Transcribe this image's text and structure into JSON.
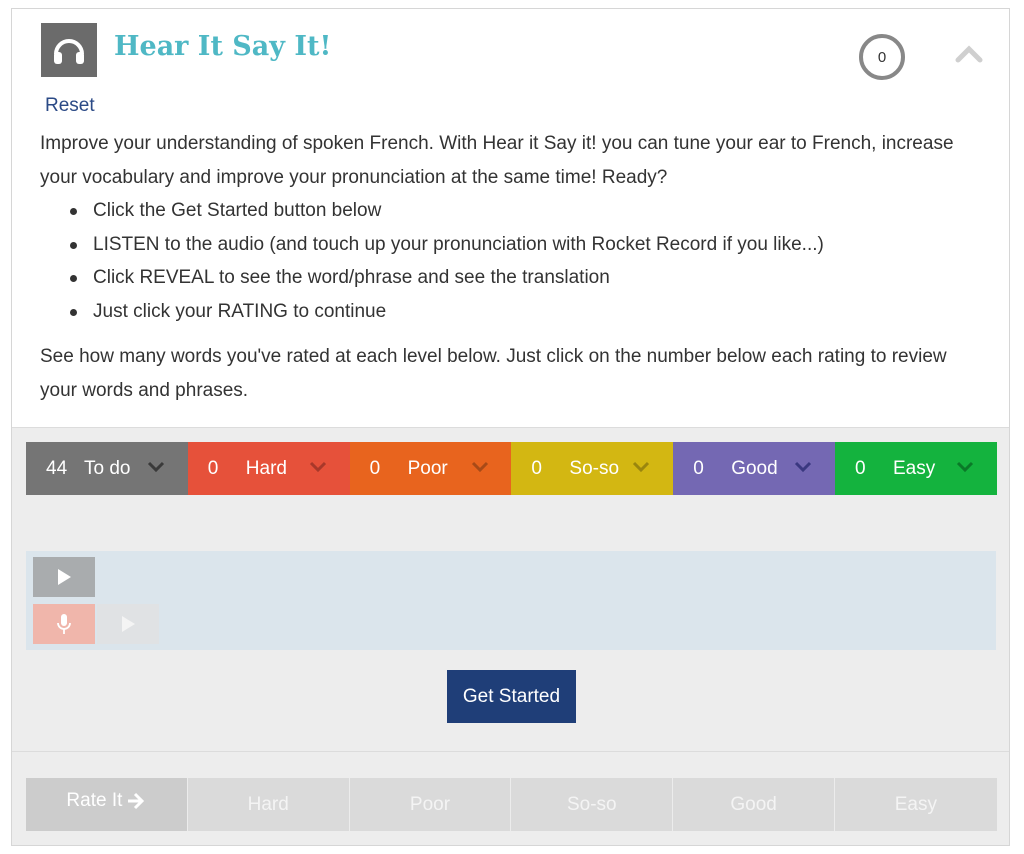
{
  "header": {
    "title": "Hear It Say It!",
    "reset_label": "Reset",
    "score": "0"
  },
  "intro": {
    "paragraph1": "Improve your understanding of spoken French. With Hear it Say it! you can tune your ear to French, increase your vocabulary and improve your pronunciation at the same time! Ready?",
    "bullets": [
      "Click the Get Started button below",
      "LISTEN to the audio (and touch up your pronunciation with Rocket Record if you like...)",
      "Click REVEAL to see the word/phrase and see the translation",
      "Just click your RATING to continue"
    ],
    "paragraph2": "See how many words you've rated at each level below. Just click on the number below each rating to review your words and phrases."
  },
  "ratings": [
    {
      "count": "44",
      "label": "To do",
      "color": "#757575",
      "chevron": "#3a3a3a"
    },
    {
      "count": "0",
      "label": "Hard",
      "color": "#e6513a",
      "chevron": "#a8382a"
    },
    {
      "count": "0",
      "label": "Poor",
      "color": "#e8641e",
      "chevron": "#a84a17"
    },
    {
      "count": "0",
      "label": "So-so",
      "color": "#d3b712",
      "chevron": "#9a860e"
    },
    {
      "count": "0",
      "label": "Good",
      "color": "#7468b3",
      "chevron": "#3a3880"
    },
    {
      "count": "0",
      "label": "Easy",
      "color": "#14b33e",
      "chevron": "#0a7a28"
    }
  ],
  "actions": {
    "get_started_label": "Get Started"
  },
  "rate": {
    "rate_it_label": "Rate It",
    "options": [
      "Hard",
      "Poor",
      "So-so",
      "Good",
      "Easy"
    ]
  },
  "icons": {
    "logo": "headphones-icon",
    "collapse": "chevron-up-icon",
    "play": "play-icon",
    "mic": "microphone-icon",
    "rate_arrow": "arrow-right-icon"
  }
}
